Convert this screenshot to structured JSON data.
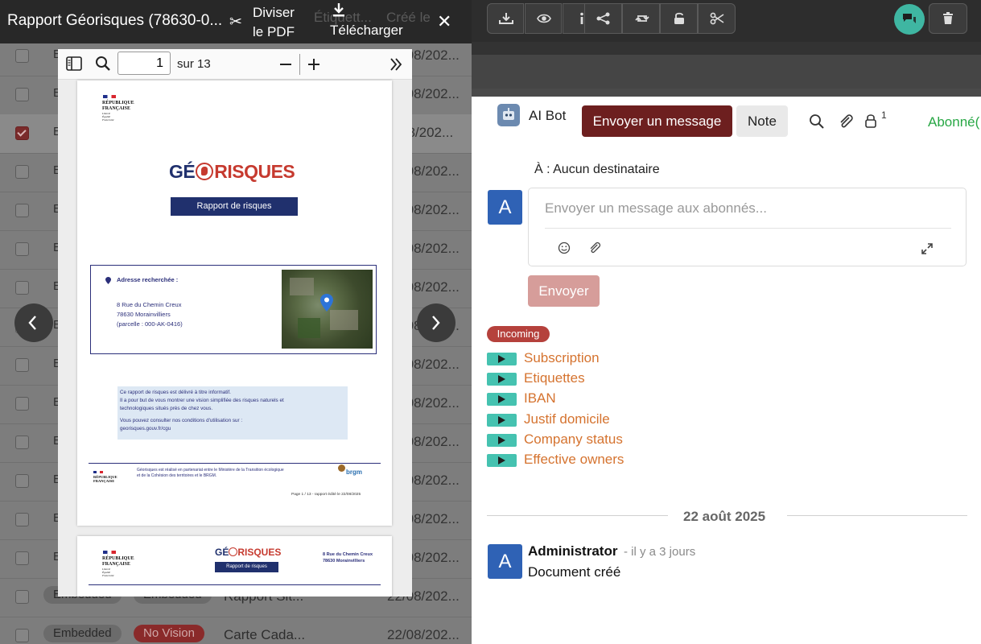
{
  "viewer": {
    "title": "Rapport Géorisques (78630-0...",
    "split_label": "Diviser le PDF",
    "download_label": "Télécharger",
    "ghost_col1": "Étiquett...",
    "ghost_col2": "Créé le"
  },
  "pdf_toolbar": {
    "page_value": "1",
    "page_total": "sur 13"
  },
  "page1": {
    "rf_line1": "RÉPUBLIQUE",
    "rf_line2": "FRANÇAISE",
    "rf_motto": "Liberté Égalité Fraternité",
    "logo_left": "GÉ",
    "logo_right": "RISQUES",
    "banner": "Rapport de risques",
    "addr_heading": "Adresse recherchée :",
    "addr_line1": "8 Rue du Chemin Creux",
    "addr_line2": "78630 Morainvilliers",
    "addr_line3": "(parcelle : 000-AK-0416)",
    "info_l1": "Ce rapport de risques est délivré à titre informatif.",
    "info_l2": "Il a pour but de vous montrer une vision simplifiée des risques naturels et",
    "info_l3": "technologiques situés près de chez vous.",
    "info_l4": "Vous pouvez consulter nos conditions d'utilisation sur :",
    "info_l5": "georisques.gouv.fr/cgu",
    "footer_l1": "Géorisques est réalisé en partenariat entre le Ministère de la Transition écologique",
    "footer_l2": "et de la Cohésion des territoires et le BRGM.",
    "brgm": "brgm",
    "page_footer": "Page 1 / 13 - rapport édité le 22/08/2025"
  },
  "page2": {
    "banner": "Rapport de risques",
    "addr_line1": "8 Rue du Chemin Creux",
    "addr_line2": "78630 Morainvilliers"
  },
  "bg_list": {
    "e_letter": "E",
    "date": "22/08/202...",
    "date_sel": "08/202...",
    "tag_embedded": "Embedded",
    "tag_novision": "No Vision",
    "title_a": "Rapport Sit...",
    "title_b": "Carte Cada..."
  },
  "chatter": {
    "bot_name": "AI Bot",
    "send_message_btn": "Envoyer un message",
    "note_btn": "Note",
    "followers_count": "1",
    "subscribed": "Abonné(",
    "to_label": "À : Aucun destinataire",
    "composer_placeholder": "Envoyer un message aux abonnés...",
    "send_btn": "Envoyer",
    "avatar_letter": "A",
    "incoming_badge": "Incoming",
    "folds": [
      "Subscription",
      "Etiquettes",
      "IBAN",
      "Justif domicile",
      "Company status",
      "Effective owners"
    ],
    "date_separator": "22 août 2025",
    "msg_author": "Administrator",
    "msg_time": "- il y a 3 jours",
    "msg_body": "Document créé"
  },
  "colors": {
    "primary_dark_red": "#6d1f1f",
    "accent_teal": "#45c2b0",
    "orange_link": "#d5732f",
    "avatar_blue": "#2f62b5",
    "followers_green": "#28a745"
  }
}
